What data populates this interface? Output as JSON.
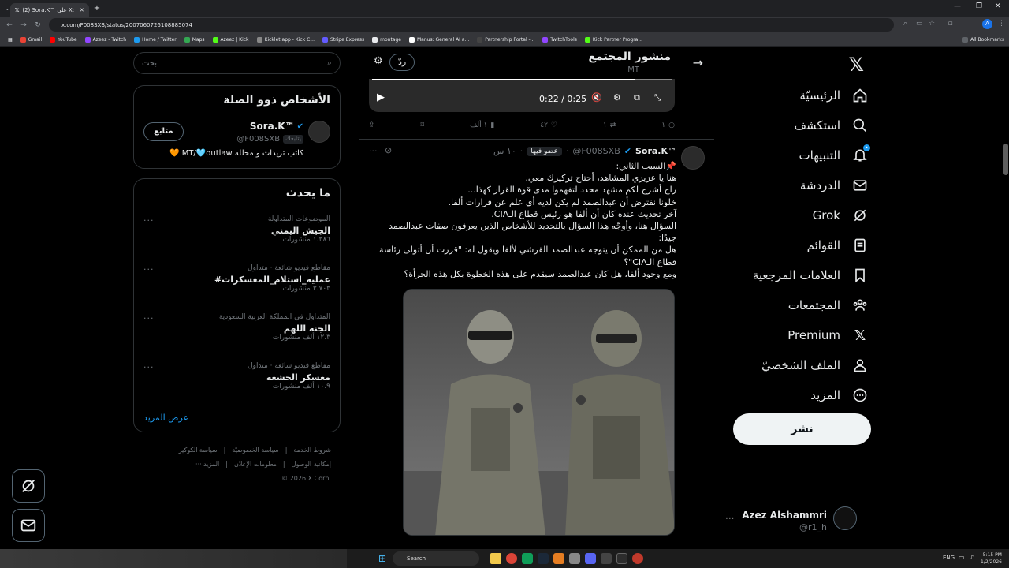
{
  "browser": {
    "tabs": [
      {
        "label": "(2) Sora.K™ على X: \"⚠️ 'المجتمع والـ...",
        "active": true
      },
      {
        "label": "",
        "active": false
      }
    ],
    "url": "x.com/F008SXB/status/2007060726108885074",
    "bookmarks": [
      "Gmail",
      "YouTube",
      "Azeez - Twitch",
      "Home / Twitter",
      "Maps",
      "Azeez | Kick",
      "Kicklet.app - Kick C...",
      "Stripe Express",
      "montage",
      "Manus: General AI a...",
      "Partnership Portal -...",
      "TwitchTools",
      "Kick Partner Progra..."
    ],
    "all_bookmarks": "All Bookmarks"
  },
  "nav": {
    "items": [
      {
        "label": "الرئيسيّة",
        "icon": "home-icon"
      },
      {
        "label": "استكشف",
        "icon": "search-icon"
      },
      {
        "label": "التنبيهات",
        "icon": "bell-icon",
        "badge": "•"
      },
      {
        "label": "الدردشة",
        "icon": "mail-icon"
      },
      {
        "label": "Grok",
        "icon": "grok-icon"
      },
      {
        "label": "القوائم",
        "icon": "list-icon"
      },
      {
        "label": "العلامات المرجعية",
        "icon": "bookmark-icon"
      },
      {
        "label": "المجتمعات",
        "icon": "communities-icon"
      },
      {
        "label": "Premium",
        "icon": "x-logo-icon"
      },
      {
        "label": "الملف الشخصيّ",
        "icon": "person-icon"
      },
      {
        "label": "المزيد",
        "icon": "more-circle-icon"
      }
    ],
    "post_label": "نشر",
    "account_name": "Azez Alshammri",
    "account_handle": "@r1_h",
    "account_more": "···"
  },
  "main": {
    "header_title": "منشور المجتمع",
    "header_sub": "MT",
    "reply_label": "ردّ",
    "video": {
      "time": "0:22 / 0:25"
    },
    "tweet1_actions": {
      "replies": "١",
      "reposts": "١",
      "likes": "٤٢",
      "views": "١ ألف"
    },
    "tweet2": {
      "name": "Sora.K™",
      "handle": "@F008SXB",
      "badge": "عضو فيها",
      "time": "١٠ س",
      "body": [
        "📌السبب الثاني:",
        "هنا يا عزيزي المشاهد، أحتاج تركيزك معي.",
        "راح أشرح لكم مشهد محدد لتفهموا مدى قوة القرار كهذا...",
        "خلونا نفترض أن عبدالصمد لم يكن لديه أي علم عن قرارات ألفا.",
        "آخر تحديث عنده كان أن ألفا هو رئيس قطاع الـCIA.",
        "السؤال هنا، وأوجّه هذا السؤال بالتحديد للأشخاص الذين يعرفون صفات عبدالصمد جيدًا:",
        "هل من الممكن أن يتوجه عبدالصمد القرشي لألفا ويقول له: \"قررت أن أتولى رئاسة قطاع الـCIA\"؟",
        "ومع وجود ألفا، هل كان عبدالصمد سيقدم على هذه الخطوة بكل هذه الجرأة؟"
      ]
    }
  },
  "right": {
    "search_placeholder": "بحث",
    "relevant_title": "الأشخاص ذوو الصلة",
    "person": {
      "name": "Sora.K™",
      "handle": "@F008SXB",
      "follows_you": "يتابعك",
      "bio": "كاتب ثريدات و محلله MT/🩵outlaw 🧡",
      "button": "متابَع"
    },
    "whats_happening": "ما يحدث",
    "trends": [
      {
        "meta": "الموضوعات المتداولة",
        "title": "الجيش اليمني",
        "count": "١،٣٨٦ منشورات"
      },
      {
        "meta": "مقاطع فيديو شائعة · متداول",
        "title": "#عمليه_استلام_المعسكرات",
        "count": "٣،٧٠٣ منشورات"
      },
      {
        "meta": "المتداول في المملكة العربية السعودية",
        "title": "الجنه اللهم",
        "count": "١٢،٣ ألف منشورات"
      },
      {
        "meta": "مقاطع فيديو شائعة · متداول",
        "title": "معسكر الخشعه",
        "count": "١٠،٩ ألف منشورات"
      }
    ],
    "show_more": "عرض المزيد",
    "footer": {
      "line1": [
        "شروط الخدمة",
        "سياسة الخصوصيّة",
        "سياسة الكوكيز"
      ],
      "line2": [
        "إمكانية الوصول",
        "معلومات الإعلان",
        "··· المزيد"
      ],
      "copyright": "© 2026 X Corp."
    }
  },
  "taskbar": {
    "search": "Search",
    "lang": "ENG",
    "time": "5:15 PM",
    "date": "1/2/2026"
  },
  "colors": {
    "accent": "#1d9bf0",
    "bg": "#000000",
    "border": "#2f3336",
    "muted": "#71767b"
  }
}
